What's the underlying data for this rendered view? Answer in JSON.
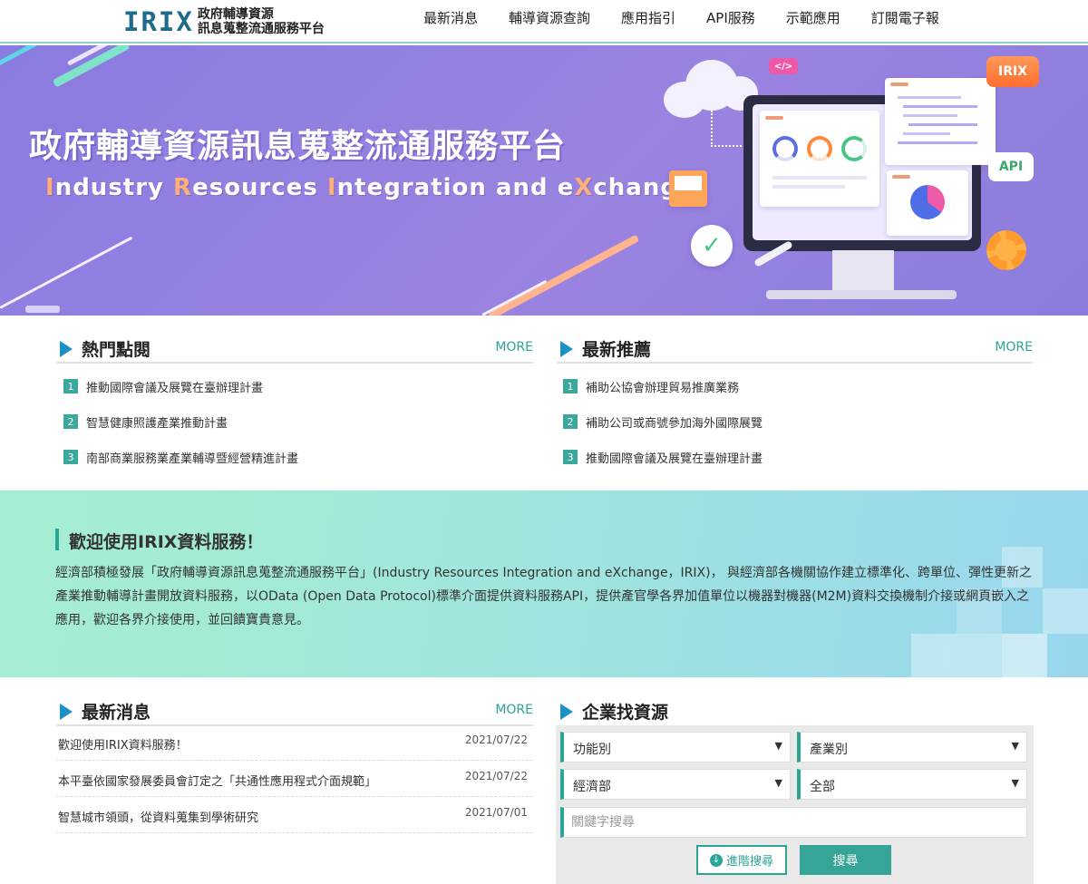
{
  "header": {
    "logo_mark": "IRIX",
    "logo_line1": "政府輔導資源",
    "logo_line2": "訊息蒐整流通服務平台",
    "nav": [
      "最新消息",
      "輔導資源查詢",
      "應用指引",
      "API服務",
      "示範應用",
      "訂閱電子報"
    ]
  },
  "banner": {
    "title": "政府輔導資源訊息蒐整流通服務平台",
    "subtitle_parts": [
      "I",
      "ndustry ",
      "R",
      "esources ",
      "I",
      "ntegration and e",
      "X",
      "change"
    ],
    "badge_code": "</>",
    "badge_irix": "IRIX",
    "badge_api": "API"
  },
  "popular": {
    "title": "熱門點閱",
    "more": "MORE",
    "items": [
      {
        "num": "1",
        "text": "推動國際會議及展覽在臺辦理計畫"
      },
      {
        "num": "2",
        "text": "智慧健康照護產業推動計畫"
      },
      {
        "num": "3",
        "text": "南部商業服務業產業輔導暨經營精進計畫"
      }
    ]
  },
  "recommend": {
    "title": "最新推薦",
    "more": "MORE",
    "items": [
      {
        "num": "1",
        "text": "補助公協會辦理貿易推廣業務"
      },
      {
        "num": "2",
        "text": "補助公司或商號參加海外國際展覽"
      },
      {
        "num": "3",
        "text": "推動國際會議及展覽在臺辦理計畫"
      }
    ]
  },
  "welcome": {
    "title": "歡迎使用IRIX資料服務！",
    "body": "經濟部積極發展「政府輔導資源訊息蒐整流通服務平台」(Industry Resources Integration and eXchange，IRIX)， 與經濟部各機關協作建立標準化、跨單位、彈性更新之產業推動輔導計畫開放資料服務，以OData (Open Data Protocol)標準介面提供資料服務API，提供產官學各界加值單位以機器對機器(M2M)資料交換機制介接或網頁嵌入之應用，歡迎各界介接使用，並回饋寶貴意見。"
  },
  "news": {
    "title": "最新消息",
    "more": "MORE",
    "items": [
      {
        "title": "歡迎使用IRIX資料服務！",
        "date": "2021/07/22"
      },
      {
        "title": "本平臺依國家發展委員會訂定之「共通性應用程式介面規範」",
        "date": "2021/07/22"
      },
      {
        "title": "智慧城市領頭，從資料蒐集到學術研究",
        "date": "2021/07/01"
      }
    ]
  },
  "search": {
    "title": "企業找資源",
    "select_function": "功能別",
    "select_industry": "產業別",
    "select_ministry": "經濟部",
    "select_all": "全部",
    "keyword_placeholder": "關鍵字搜尋",
    "advanced_label": "進階搜尋",
    "submit_label": "搜尋"
  },
  "colors": {
    "accent": "#2aa598",
    "arrow": "#1d8fc7",
    "banner": "#9b83e0"
  }
}
